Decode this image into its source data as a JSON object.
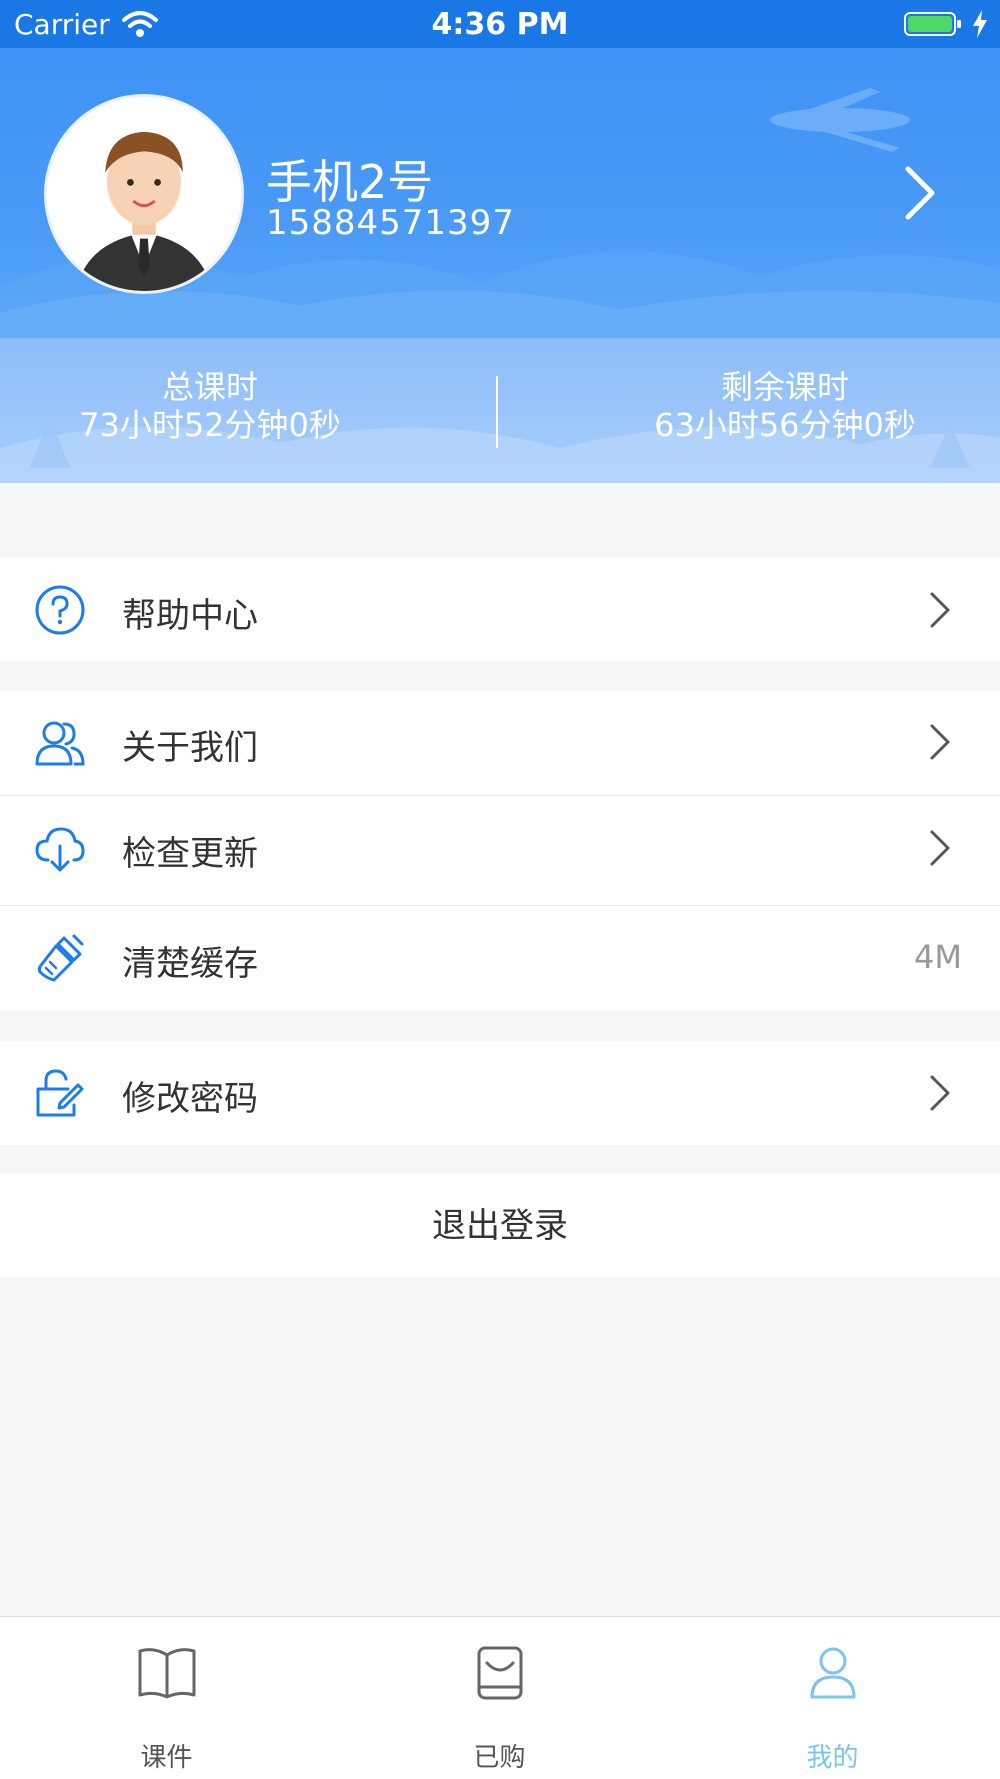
{
  "status_bar": {
    "carrier": "Carrier",
    "time": "4:36 PM"
  },
  "profile": {
    "name": "手机2号",
    "phone": "15884571397"
  },
  "stats": {
    "total_label": "总课时",
    "total_value": "73小时52分钟0秒",
    "remaining_label": "剩余课时",
    "remaining_value": "63小时56分钟0秒"
  },
  "menu": {
    "help": "帮助中心",
    "about": "关于我们",
    "update": "检查更新",
    "cache": "清楚缓存",
    "cache_size": "4M",
    "password": "修改密码"
  },
  "logout_label": "退出登录",
  "tabs": [
    {
      "label": "课件",
      "icon": "book-icon"
    },
    {
      "label": "已购",
      "icon": "bag-icon"
    },
    {
      "label": "我的",
      "icon": "person-icon"
    }
  ],
  "colors": {
    "accent": "#1a78e6",
    "header": "#4a9af6",
    "icon_blue": "#1d7de6",
    "tab_active": "#7cc4ea"
  }
}
